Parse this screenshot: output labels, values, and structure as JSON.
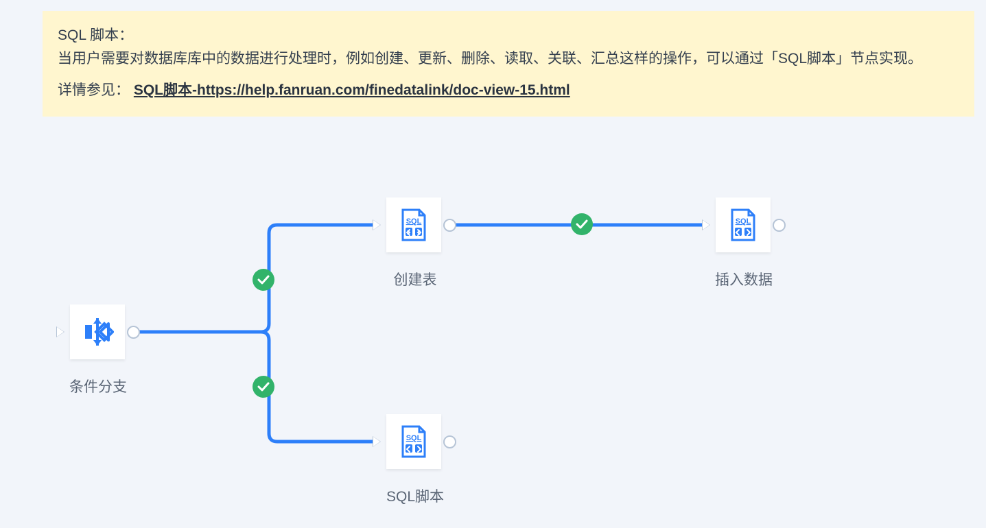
{
  "help": {
    "title": "SQL 脚本：",
    "body": "当用户需要对数据库库中的数据进行处理时，例如创建、更新、删除、读取、关联、汇总这样的操作，可以通过「SQL脚本」节点实现。",
    "detail_prefix": "详情参见：",
    "link_text": "SQL脚本-https://help.fanruan.com/finedatalink/doc-view-15.html"
  },
  "nodes": {
    "branch": {
      "label": "条件分支",
      "icon": "branch"
    },
    "create": {
      "label": "创建表",
      "icon": "sql"
    },
    "insert": {
      "label": "插入数据",
      "icon": "sql"
    },
    "script": {
      "label": "SQL脚本",
      "icon": "sql"
    }
  },
  "colors": {
    "edge": "#2d7ff9",
    "success": "#32b36a",
    "port": "#b6c4d6",
    "text": "#5a6575"
  }
}
